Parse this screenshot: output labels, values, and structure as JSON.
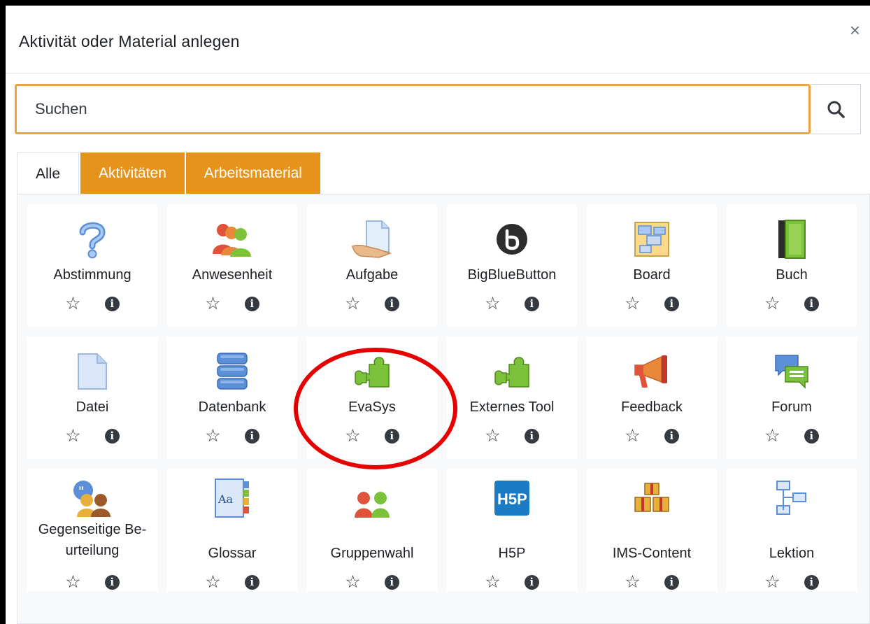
{
  "dialog": {
    "title": "Aktivität oder Material anlegen",
    "close_symbol": "×"
  },
  "search": {
    "placeholder": "Suchen",
    "value": ""
  },
  "tabs": [
    {
      "label": "Alle",
      "active": true
    },
    {
      "label": "Aktivitäten",
      "active": false
    },
    {
      "label": "Arbeitsmaterial",
      "active": false
    }
  ],
  "tiles": [
    {
      "label": "Abstimmung",
      "icon": "question-mark-icon"
    },
    {
      "label": "Anwesenheit",
      "icon": "people-icon"
    },
    {
      "label": "Aufgabe",
      "icon": "hand-document-icon"
    },
    {
      "label": "BigBlueButton",
      "icon": "bigbluebutton-logo-icon"
    },
    {
      "label": "Board",
      "icon": "board-icon"
    },
    {
      "label": "Buch",
      "icon": "book-icon"
    },
    {
      "label": "Datei",
      "icon": "file-icon"
    },
    {
      "label": "Datenbank",
      "icon": "database-icon"
    },
    {
      "label": "EvaSys",
      "icon": "puzzle-icon"
    },
    {
      "label": "Externes Tool",
      "icon": "puzzle-icon"
    },
    {
      "label": "Feedback",
      "icon": "megaphone-icon"
    },
    {
      "label": "Forum",
      "icon": "speech-bubbles-icon"
    },
    {
      "label": "Gegenseitige Be-\nurteilung",
      "icon": "peer-review-icon"
    },
    {
      "label": "Glossar",
      "icon": "glossary-icon"
    },
    {
      "label": "Gruppenwahl",
      "icon": "group-choice-icon"
    },
    {
      "label": "H5P",
      "icon": "h5p-logo-icon"
    },
    {
      "label": "IMS-Content",
      "icon": "boxes-icon"
    },
    {
      "label": "Lektion",
      "icon": "lesson-tree-icon"
    }
  ],
  "actions": {
    "star_symbol": "☆",
    "info_symbol": "i"
  },
  "colors": {
    "accent": "#e6931c",
    "search_border": "#eaa441",
    "highlight_circle": "#e60000"
  }
}
